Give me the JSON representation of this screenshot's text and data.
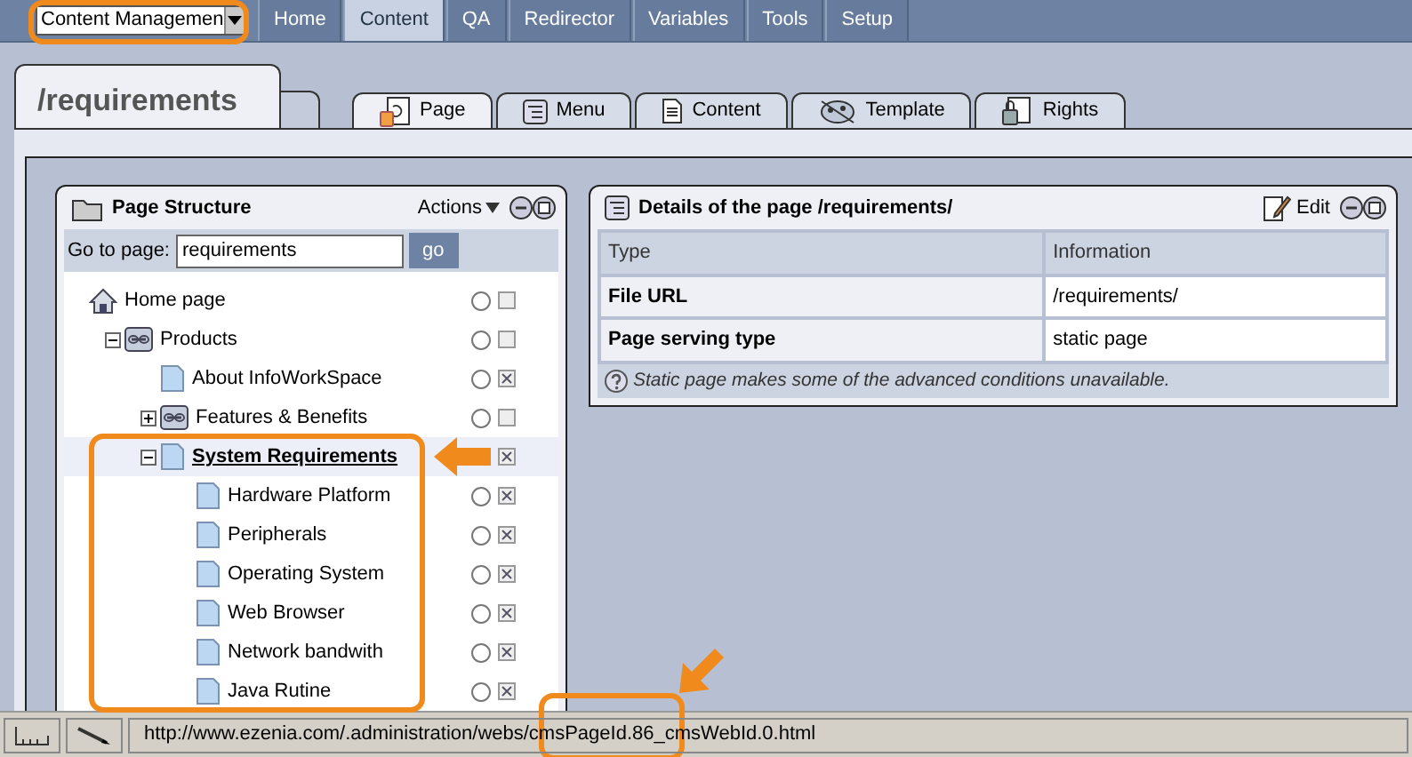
{
  "top_menu": {
    "app_select": "Content Managemen",
    "items": [
      {
        "label": "Home",
        "selected": false
      },
      {
        "label": "Content",
        "selected": true
      },
      {
        "label": "QA",
        "selected": false
      },
      {
        "label": "Redirector",
        "selected": false
      },
      {
        "label": "Variables",
        "selected": false
      },
      {
        "label": "Tools",
        "selected": false
      },
      {
        "label": "Setup",
        "selected": false
      }
    ]
  },
  "page_title": "/requirements",
  "tabs": [
    {
      "label": "Page",
      "kind": "page",
      "selected": true
    },
    {
      "label": "Menu",
      "kind": "menu",
      "selected": false
    },
    {
      "label": "Content",
      "kind": "content",
      "selected": false
    },
    {
      "label": "Template",
      "kind": "template",
      "selected": false
    },
    {
      "label": "Rights",
      "kind": "rights",
      "selected": false
    }
  ],
  "structure_panel": {
    "title": "Page Structure",
    "actions": "Actions",
    "goto_label": "Go to page:",
    "goto_value": "requirements",
    "go_button": "go",
    "tree": [
      {
        "label": "Home page",
        "kind": "home",
        "radio": true,
        "checked": false,
        "selected": false,
        "children": [
          {
            "label": "Products",
            "kind": "link",
            "expanded": true,
            "radio": true,
            "checked": false,
            "selected": false,
            "children": [
              {
                "label": "About InfoWorkSpace",
                "kind": "page",
                "radio": true,
                "checked": true,
                "selected": false
              },
              {
                "label": "Features & Benefits",
                "kind": "link",
                "expanded": false,
                "radio": true,
                "checked": false,
                "selected": false
              },
              {
                "label": "System Requirements",
                "kind": "page",
                "expanded": true,
                "radio": false,
                "checked": true,
                "selected": true,
                "children": [
                  {
                    "label": "Hardware Platform",
                    "kind": "page",
                    "radio": true,
                    "checked": true,
                    "selected": false
                  },
                  {
                    "label": "Peripherals",
                    "kind": "page",
                    "radio": true,
                    "checked": true,
                    "selected": false
                  },
                  {
                    "label": "Operating System",
                    "kind": "page",
                    "radio": true,
                    "checked": true,
                    "selected": false
                  },
                  {
                    "label": "Web Browser",
                    "kind": "page",
                    "radio": true,
                    "checked": true,
                    "selected": false
                  },
                  {
                    "label": "Network bandwith",
                    "kind": "page",
                    "radio": true,
                    "checked": true,
                    "selected": false
                  },
                  {
                    "label": "Java Rutine",
                    "kind": "page",
                    "radio": true,
                    "checked": true,
                    "selected": false
                  }
                ]
              }
            ]
          }
        ]
      }
    ]
  },
  "details_panel": {
    "title": "Details of the page /requirements/",
    "edit": "Edit",
    "columns": [
      "Type",
      "Information"
    ],
    "rows": [
      [
        "File URL",
        "/requirements/"
      ],
      [
        "Page serving type",
        "static page"
      ]
    ],
    "note": "Static page makes some of the advanced conditions unavailable."
  },
  "status_bar": {
    "url": "http://www.ezenia.com/.administration/webs/cmsPageId.86_cmsWebId.0.html"
  }
}
